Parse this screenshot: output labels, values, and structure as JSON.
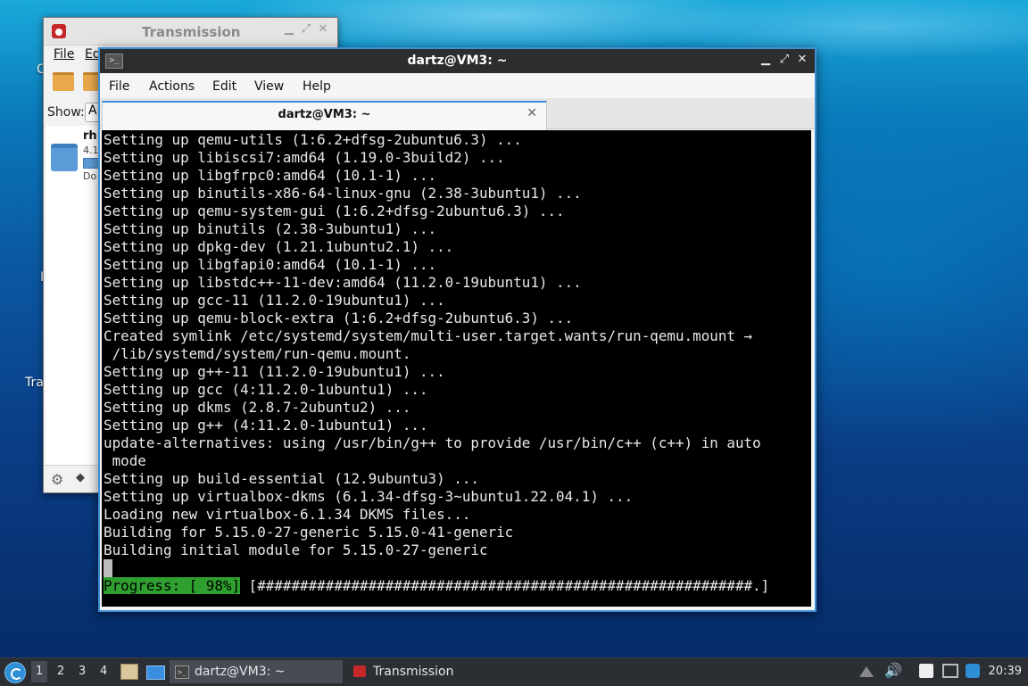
{
  "desktop": {
    "labels": [
      "C",
      "I",
      "Tra"
    ]
  },
  "transmission": {
    "title": "Transmission",
    "menu": [
      "File",
      "Ed"
    ],
    "show_label": "Show:",
    "show_value": "A",
    "torrent": {
      "name": "rh",
      "size": "4.1",
      "status": "Do",
      "progress": 1.0
    }
  },
  "terminal": {
    "title": "dartz@VM3: ~",
    "menu": [
      "File",
      "Actions",
      "Edit",
      "View",
      "Help"
    ],
    "tab_label": "dartz@VM3: ~",
    "lines": [
      "Setting up qemu-utils (1:6.2+dfsg-2ubuntu6.3) ...",
      "Setting up libiscsi7:amd64 (1.19.0-3build2) ...",
      "Setting up libgfrpc0:amd64 (10.1-1) ...",
      "Setting up binutils-x86-64-linux-gnu (2.38-3ubuntu1) ...",
      "Setting up qemu-system-gui (1:6.2+dfsg-2ubuntu6.3) ...",
      "Setting up binutils (2.38-3ubuntu1) ...",
      "Setting up dpkg-dev (1.21.1ubuntu2.1) ...",
      "Setting up libgfapi0:amd64 (10.1-1) ...",
      "Setting up libstdc++-11-dev:amd64 (11.2.0-19ubuntu1) ...",
      "Setting up gcc-11 (11.2.0-19ubuntu1) ...",
      "Setting up qemu-block-extra (1:6.2+dfsg-2ubuntu6.3) ...",
      "Created symlink /etc/systemd/system/multi-user.target.wants/run-qemu.mount →",
      " /lib/systemd/system/run-qemu.mount.",
      "Setting up g++-11 (11.2.0-19ubuntu1) ...",
      "Setting up gcc (4:11.2.0-1ubuntu1) ...",
      "Setting up dkms (2.8.7-2ubuntu2) ...",
      "Setting up g++ (4:11.2.0-1ubuntu1) ...",
      "update-alternatives: using /usr/bin/g++ to provide /usr/bin/c++ (c++) in auto",
      " mode",
      "Setting up build-essential (12.9ubuntu3) ...",
      "Setting up virtualbox-dkms (6.1.34-dfsg-3~ubuntu1.22.04.1) ...",
      "Loading new virtualbox-6.1.34 DKMS files...",
      "Building for 5.15.0-27-generic 5.15.0-41-generic",
      "Building initial module for 5.15.0-27-generic"
    ],
    "progress_label": "Progress: [ 98%]",
    "progress_bar": " [##########################################################.]"
  },
  "taskbar": {
    "workspaces": [
      "1",
      "2",
      "3",
      "4"
    ],
    "active_workspace": "1",
    "tasks": [
      {
        "label": "dartz@VM3: ~",
        "icon": "terminal-icon",
        "active": true
      },
      {
        "label": "Transmission",
        "icon": "transmission-icon",
        "active": false
      }
    ],
    "clock": "20:39"
  }
}
